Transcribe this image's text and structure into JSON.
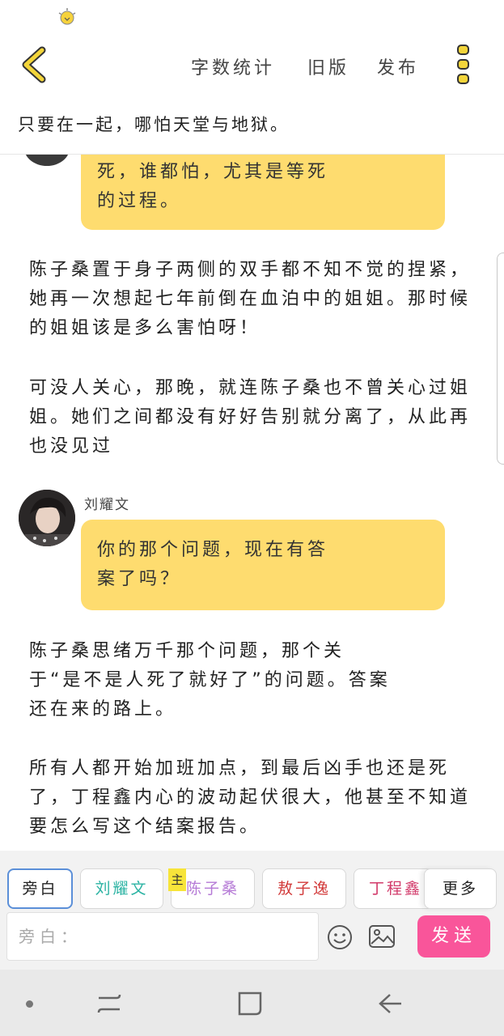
{
  "header": {
    "word_count": "字数统计",
    "old_version": "旧版",
    "publish": "发布"
  },
  "title_line": "只要在一起，哪怕天堂与地狱。",
  "story": {
    "bubble1": [
      "死，谁都怕，尤其是等死",
      "的过程。"
    ],
    "para1": "陈子桑置于身子两侧的双手都不知不觉的捏紧，她再一次想起七年前倒在血泊中的姐姐。那时候的姐姐该是多么害怕呀！",
    "para2": "可没人关心，那晚，就连陈子桑也不曾关心过姐姐。她们之间都没有好好告别就分离了，从此再也没见过",
    "speaker": "刘耀文",
    "bubble2": [
      "你的那个问题，现在有答",
      "案了吗？"
    ],
    "para3": [
      "陈子桑思绪万千那个问题，那个关",
      "于“是不是人死了就好了”的问题。答案",
      "还在来的路上。"
    ],
    "para4": "所有人都开始加班加点，到最后凶手也还是死了，丁程鑫内心的波动起伏很大，他甚至不知道要怎么写这个结案报告。"
  },
  "roles": [
    {
      "label": "旁白",
      "color": "#444444"
    },
    {
      "label": "刘耀文",
      "color": "#2bb3a3"
    },
    {
      "label": "陈子桑",
      "color": "#b57ad6"
    },
    {
      "label": "敖子逸",
      "color": "#d23a3a"
    },
    {
      "label": "丁程鑫",
      "color": "#d23a6a"
    },
    {
      "label": "更多",
      "color": "#444444"
    }
  ],
  "main_badge": "主",
  "input": {
    "label": "旁白："
  },
  "send": "发送",
  "colors": {
    "bubble": "#fedc6f",
    "send": "#f9559a",
    "back_arrow": "#f3d53a"
  }
}
